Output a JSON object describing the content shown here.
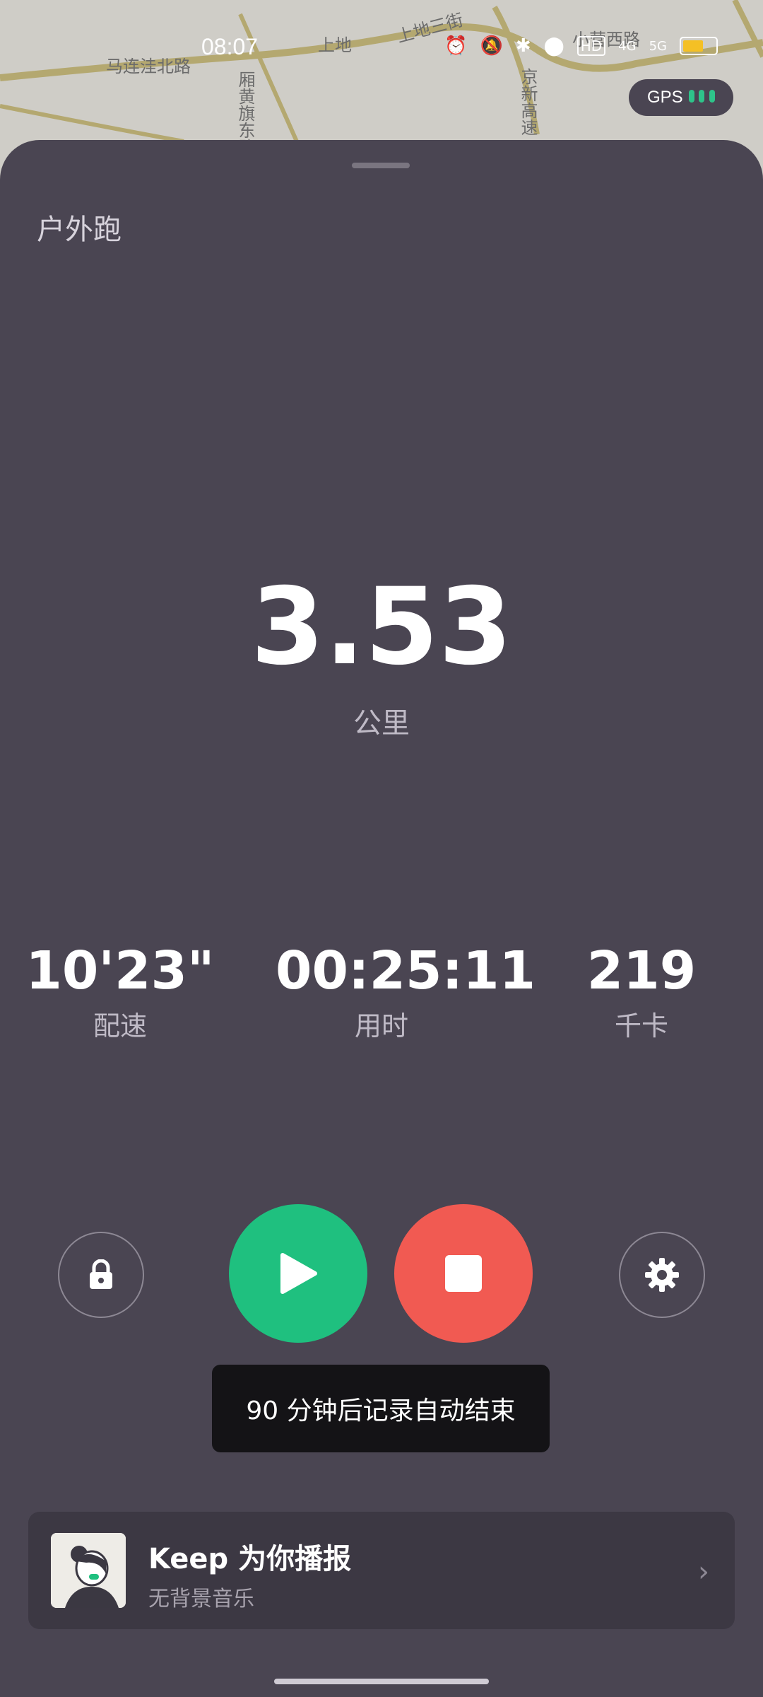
{
  "status_bar": {
    "time": "08:07",
    "battery_level": 0.6,
    "network": [
      "4G",
      "5G"
    ]
  },
  "map": {
    "labels": [
      "马连洼北路",
      "上地",
      "上地三街",
      "厢黄旗东路",
      "京新高速",
      "小营西路"
    ]
  },
  "gps": {
    "label": "GPS",
    "signal_bars": 3
  },
  "sport": {
    "title": "户外跑"
  },
  "distance": {
    "value": "3.53",
    "unit": "公里"
  },
  "stats": [
    {
      "value": "10'23\"",
      "label": "配速"
    },
    {
      "value": "00:25:11",
      "label": "用时"
    },
    {
      "value": "219",
      "label": "千卡"
    }
  ],
  "controls": {
    "lock_icon": "lock-icon",
    "play_icon": "play-icon",
    "stop_icon": "stop-icon",
    "settings_icon": "gear-icon",
    "play_color": "#1fc07f",
    "stop_color": "#f15a52"
  },
  "toast": {
    "text": "90 分钟后记录自动结束"
  },
  "audio_card": {
    "title": "Keep 为你播报",
    "subtitle": "无背景音乐"
  }
}
